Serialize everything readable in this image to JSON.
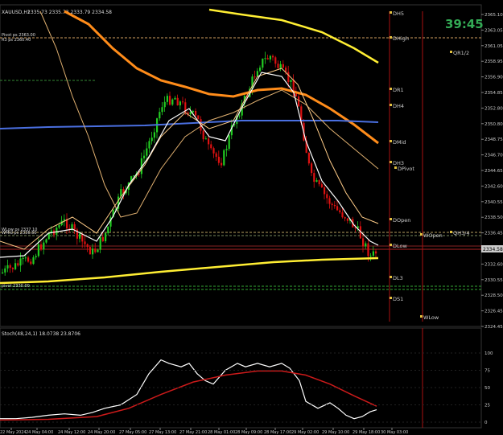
{
  "header": {
    "symbol_info": "XAUUSD,H1",
    "ohlc": "2335.73 2335.73 2333.79 2334.58"
  },
  "timer": "39:45",
  "current_price": "2334.58",
  "indicator_label": "Stoch(48,24,1) 18.0738 23.8706",
  "colors": {
    "background": "#000000",
    "bull": "#22cc22",
    "bear": "#dd1111",
    "price_axis_text": "#c8c8c8",
    "timer": "#33aa55",
    "ma_orange": "#ff8c1a",
    "ma_yellow": "#ffee33",
    "ma_blue": "#4a6fe0",
    "ma_tan": "#e0b070",
    "stoch_main": "#ffffff",
    "stoch_signal": "#cc1a1a"
  },
  "price_axis": [
    "2365.10",
    "2363.05",
    "2361.05",
    "2358.95",
    "2356.90",
    "2354.85",
    "2352.80",
    "2350.80",
    "2348.75",
    "2346.70",
    "2344.65",
    "2342.60",
    "2340.55",
    "2338.50",
    "2336.45",
    "2334.40",
    "2332.60",
    "2330.55",
    "2328.50",
    "2326.45",
    "2324.45"
  ],
  "stoch_axis": [
    "100",
    "75",
    "50",
    "25",
    "0"
  ],
  "time_axis": [
    "22 May 2024",
    "24 May 04:00",
    "24 May 12:00",
    "24 May 20:00",
    "27 May 05:00",
    "27 May 13:00",
    "27 May 21:00",
    "28 May 01:00",
    "28 May 09:00",
    "28 May 17:00",
    "29 May 02:00",
    "29 May 10:00",
    "29 May 18:00",
    "30 May 03:00"
  ],
  "levels": [
    {
      "label": "DH5",
      "color": "#cccccc"
    },
    {
      "label": "DHigh",
      "color": "#cccccc"
    },
    {
      "label": "DR1",
      "color": "#cccccc"
    },
    {
      "label": "DH4",
      "color": "#cccccc"
    },
    {
      "label": "DMid",
      "color": "#cccccc"
    },
    {
      "label": "DH3",
      "color": "#cccccc"
    },
    {
      "label": "DPivot",
      "color": "#cccccc"
    },
    {
      "label": "DOpen",
      "color": "#cccccc"
    },
    {
      "label": "DLow",
      "color": "#cccccc"
    },
    {
      "label": "DL3",
      "color": "#cccccc"
    },
    {
      "label": "DS1",
      "color": "#cccccc"
    },
    {
      "label": "WOpen",
      "color": "#cccccc"
    },
    {
      "label": "WLow",
      "color": "#cccccc"
    },
    {
      "label": "QR1/2",
      "color": "#cccccc"
    },
    {
      "label": "QH3/4",
      "color": "#cccccc"
    }
  ],
  "left_labels": [
    "Pivot ps 2363.00",
    "R3 ps 2360.40",
    "WLow ps 2337.10",
    "WMid ps 2336.60",
    "pivot 2330.00"
  ]
}
